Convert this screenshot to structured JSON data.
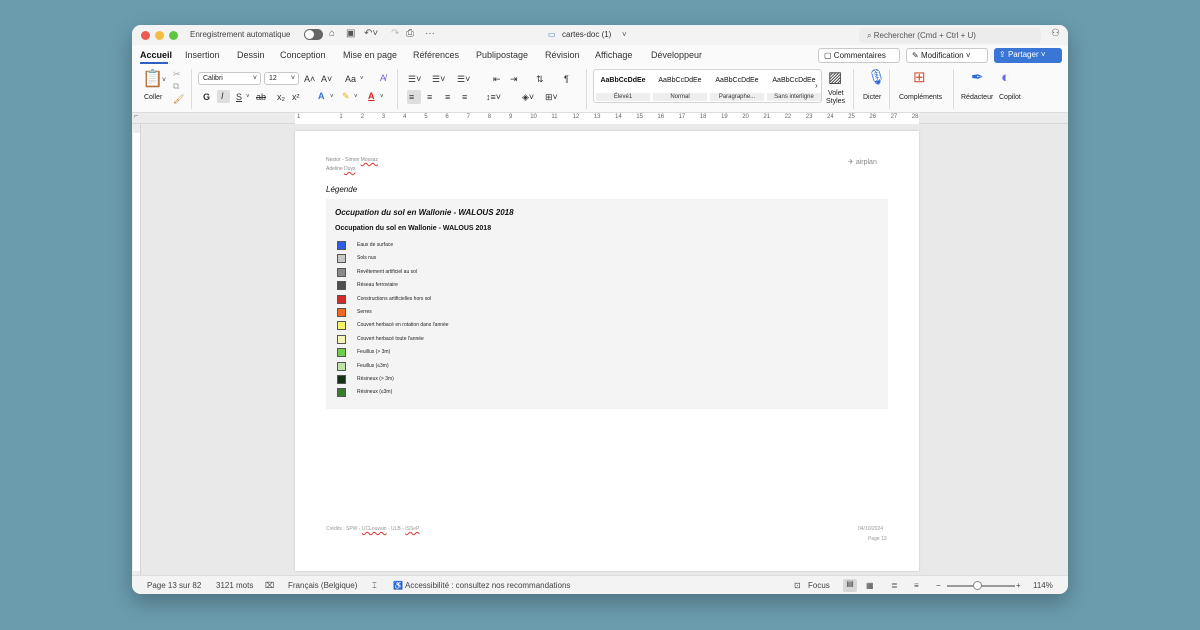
{
  "titlebar": {
    "autosave_label": "Enregistrement automatique",
    "document_title": "cartes-doc (1)",
    "search_placeholder": "Rechercher (Cmd + Ctrl + U)"
  },
  "tabs": [
    "Accueil",
    "Insertion",
    "Dessin",
    "Conception",
    "Mise en page",
    "Références",
    "Publipostage",
    "Révision",
    "Affichage",
    "Développeur"
  ],
  "header_buttons": {
    "comments": "Commentaires",
    "editing": "Modification",
    "share": "Partager"
  },
  "ribbon": {
    "paste_label": "Coller",
    "font_name": "Calibri",
    "font_size": "12",
    "bold": "G",
    "italic": "I",
    "underline": "S",
    "strike": "ab",
    "subscript": "x₂",
    "superscript": "x²",
    "case": "Aa",
    "font_grow": "A˄",
    "font_shrink": "A˅",
    "styles": [
      {
        "preview": "AaBbCcDdEe",
        "name": "Élevé1"
      },
      {
        "preview": "AaBbCcDdEe",
        "name": "Normal"
      },
      {
        "preview": "AaBbCcDdEe",
        "name": "Paragraphe..."
      },
      {
        "preview": "AaBbCcDdEe",
        "name": "Sans interligne"
      }
    ],
    "styles_pane_line1": "Volet",
    "styles_pane_line2": "Styles",
    "dictate": "Dicter",
    "addins": "Compléments",
    "editor": "Rédacteur",
    "copilot": "Copilot"
  },
  "ruler": {
    "numbers": [
      "1",
      "",
      "1",
      "2",
      "3",
      "4",
      "5",
      "6",
      "7",
      "8",
      "9",
      "10",
      "11",
      "12",
      "13",
      "14",
      "15",
      "16",
      "17",
      "18",
      "19",
      "20",
      "21",
      "22",
      "23",
      "24",
      "25",
      "26",
      "27",
      "28"
    ]
  },
  "page": {
    "header_line1_prefix": "Nestor - Simon ",
    "header_line1_name": "Mossaz",
    "header_line2_prefix": "Adeline ",
    "header_line2_name": "Duys",
    "logo_text": "airplan",
    "legend_title": "Légende",
    "box_title": "Occupation du sol en Wallonie - WALOUS 2018",
    "box_subtitle": "Occupation du sol en Wallonie - WALOUS 2018",
    "legend_items": [
      {
        "color": "#2f5ee6",
        "label": "Eaux de surface"
      },
      {
        "color": "#c8c8c8",
        "label": "Sols nus"
      },
      {
        "color": "#8a8a8a",
        "label": "Revêtement artificiel au sol"
      },
      {
        "color": "#4f4f4f",
        "label": "Réseau ferroviaire"
      },
      {
        "color": "#d32a2a",
        "label": "Constructions artificielles hors sol"
      },
      {
        "color": "#ee6a23",
        "label": "Serres"
      },
      {
        "color": "#f7f26a",
        "label": "Couvert herbacé en rotation dans l'année"
      },
      {
        "color": "#f3f6b8",
        "label": "Couvert herbacé toute l'année"
      },
      {
        "color": "#6fcf4c",
        "label": "Feuillus (> 3m)"
      },
      {
        "color": "#bfe3a8",
        "label": "Feuillus (≤3m)"
      },
      {
        "color": "#143314",
        "label": "Résineux (> 3m)"
      },
      {
        "color": "#3a7c2c",
        "label": "Résineux (≤3m)"
      }
    ],
    "credits_prefix": "Crédits : SPW - ",
    "credits_u1": "UCLouvain",
    "credits_mid": " - ULB - ",
    "credits_u2": "ISSeP",
    "date": "04/10/2024",
    "page_label": "Page 13"
  },
  "status": {
    "page": "Page 13 sur 82",
    "words": "3121 mots",
    "language": "Français (Belgique)",
    "accessibility": "Accessibilité : consultez nos recommandations",
    "focus": "Focus",
    "zoom": "114%",
    "zoom_minus": "−",
    "zoom_plus": "+"
  }
}
